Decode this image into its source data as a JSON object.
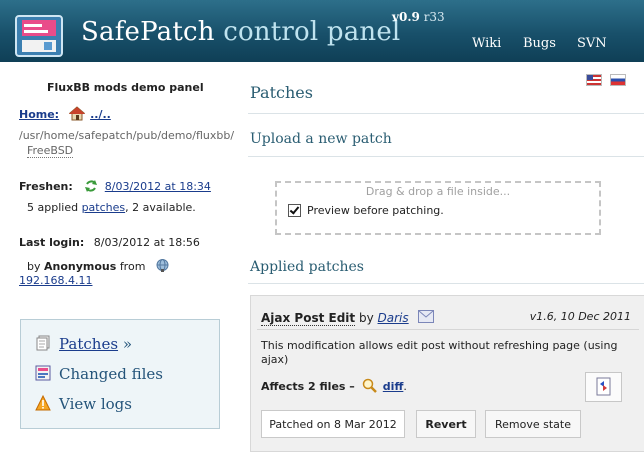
{
  "header": {
    "title_main": "SafePatch",
    "title_sub": "control panel",
    "version": "v0.9",
    "revision": "r33",
    "nav": [
      {
        "label": "Wiki"
      },
      {
        "label": "Bugs"
      },
      {
        "label": "SVN"
      }
    ]
  },
  "sidebar": {
    "panel_name": "FluxBB mods demo panel",
    "home_label": "Home:",
    "home_link": "../..",
    "path": "/usr/home/safepatch/pub/demo/fluxbb/",
    "os": "FreeBSD",
    "freshen_label": "Freshen:",
    "freshen_date": "8/03/2012 at 18:34",
    "applied_count": "5 applied",
    "patches_link": "patches",
    "available": ", 2 available.",
    "last_login_label": "Last login:",
    "last_login_value": "8/03/2012 at 18:56",
    "by_text": "by",
    "user": "Anonymous",
    "from_text": "from",
    "ip": "192.168.4.11",
    "nav": [
      {
        "label": "Patches",
        "suffix": "»"
      },
      {
        "label": "Changed files"
      },
      {
        "label": "View logs"
      }
    ]
  },
  "main": {
    "page_title": "Patches",
    "upload_title": "Upload a new patch",
    "drop_hint": "Drag & drop a file inside...",
    "preview_label": "Preview before patching.",
    "preview_checked": true,
    "applied_title": "Applied patches",
    "patch": {
      "name": "Ajax Post Edit",
      "by": "by",
      "author": "Daris",
      "version": "v1.6, 10 Dec 2011",
      "description": "This modification allows edit post without refreshing page (using ajax)",
      "affects": "Affects 2 files –",
      "diff_link": "diff",
      "diff_suffix": ".",
      "status": "Patched on 8 Mar 2012",
      "revert_label": "Revert",
      "remove_label": "Remove state"
    }
  },
  "colors": {
    "header_bg": "#18506a",
    "heading": "#2a5d72",
    "link": "#1a3c8c"
  }
}
